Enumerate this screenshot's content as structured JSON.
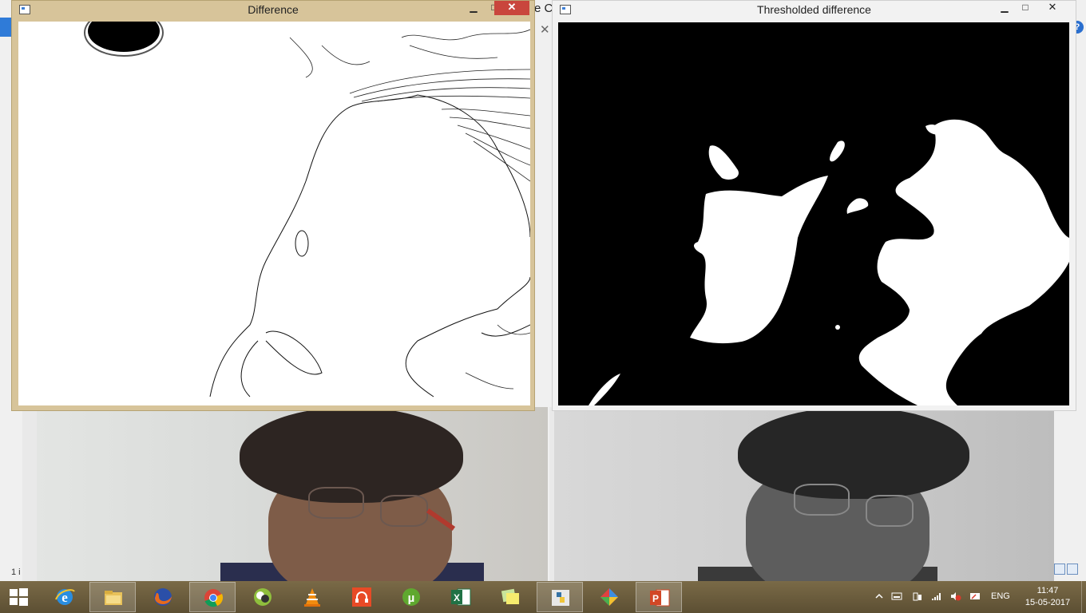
{
  "windows": {
    "difference": {
      "title": "Difference",
      "close_glyph": "✕",
      "min_glyph": "▁",
      "max_glyph": "□"
    },
    "thresholded": {
      "title": "Thresholded difference",
      "close_glyph": "✕",
      "min_glyph": "▁",
      "max_glyph": "□"
    }
  },
  "background_app": {
    "cut_title": "e C",
    "help_glyph": "?",
    "status_fragment": "1 i"
  },
  "taskbar": {
    "apps": [
      "internet-explorer",
      "file-explorer",
      "firefox",
      "chrome",
      "cheese-camera",
      "vlc",
      "music-player",
      "utorrent",
      "excel",
      "sticky-notes",
      "python-idle",
      "paint-tool",
      "powerpoint"
    ],
    "language": "ENG",
    "time": "11:47",
    "date": "15-05-2017"
  },
  "colors": {
    "taskbar": "#6b5d3e",
    "difference_frame": "#d7c49a",
    "close_button": "#c9463d"
  }
}
